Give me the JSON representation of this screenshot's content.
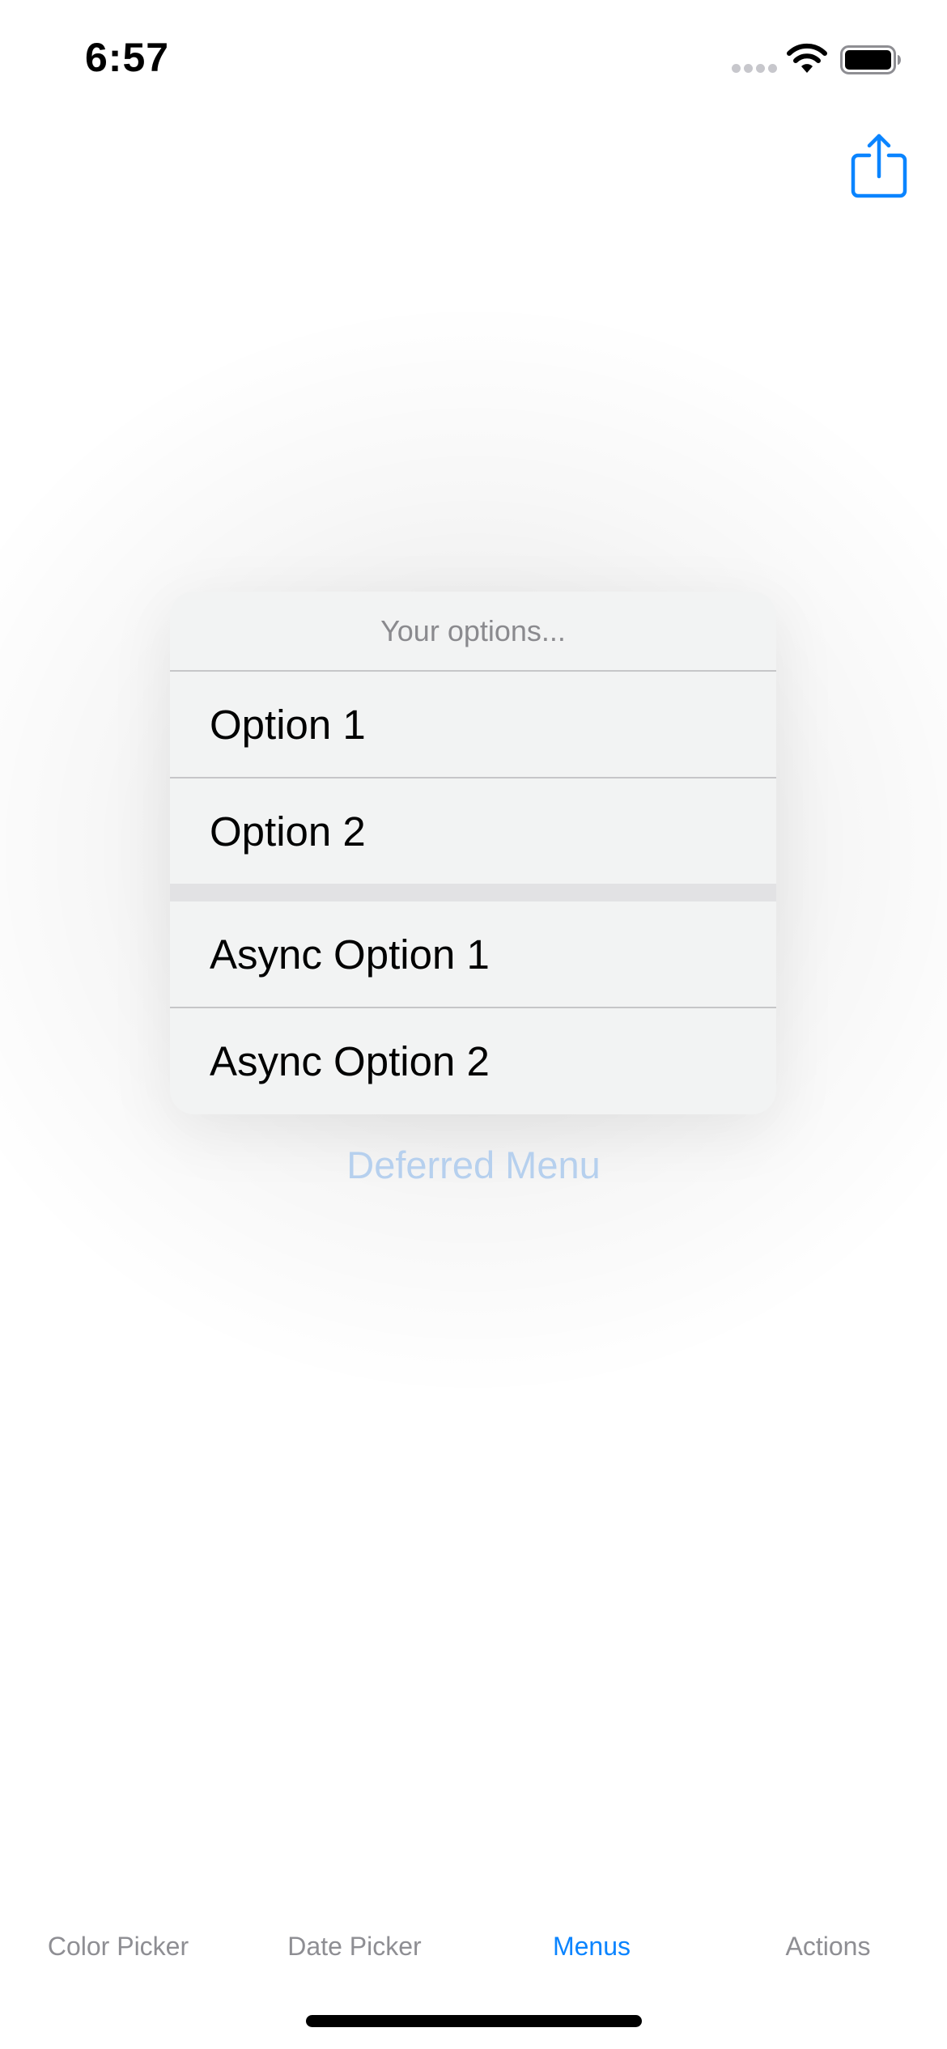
{
  "status_bar": {
    "time": "6:57"
  },
  "menu": {
    "header": "Your options...",
    "groups": [
      {
        "items": [
          {
            "label": "Option 1"
          },
          {
            "label": "Option 2"
          }
        ]
      },
      {
        "items": [
          {
            "label": "Async Option 1"
          },
          {
            "label": "Async Option 2"
          }
        ]
      }
    ]
  },
  "trigger": {
    "label": "Deferred Menu"
  },
  "tabs": [
    {
      "label": "Color Picker",
      "active": false
    },
    {
      "label": "Date Picker",
      "active": false
    },
    {
      "label": "Menus",
      "active": true
    },
    {
      "label": "Actions",
      "active": false
    }
  ],
  "colors": {
    "accent": "#0a84ff",
    "tab_inactive": "#8e8e93",
    "menu_background": "#f2f3f3",
    "deferred_title_dimmed": "#b6d0ee"
  },
  "icons": {
    "share": "square-and-arrow-up-icon",
    "wifi": "wifi-icon",
    "battery": "battery-full-icon",
    "signal": "cellular-signal-icon"
  }
}
